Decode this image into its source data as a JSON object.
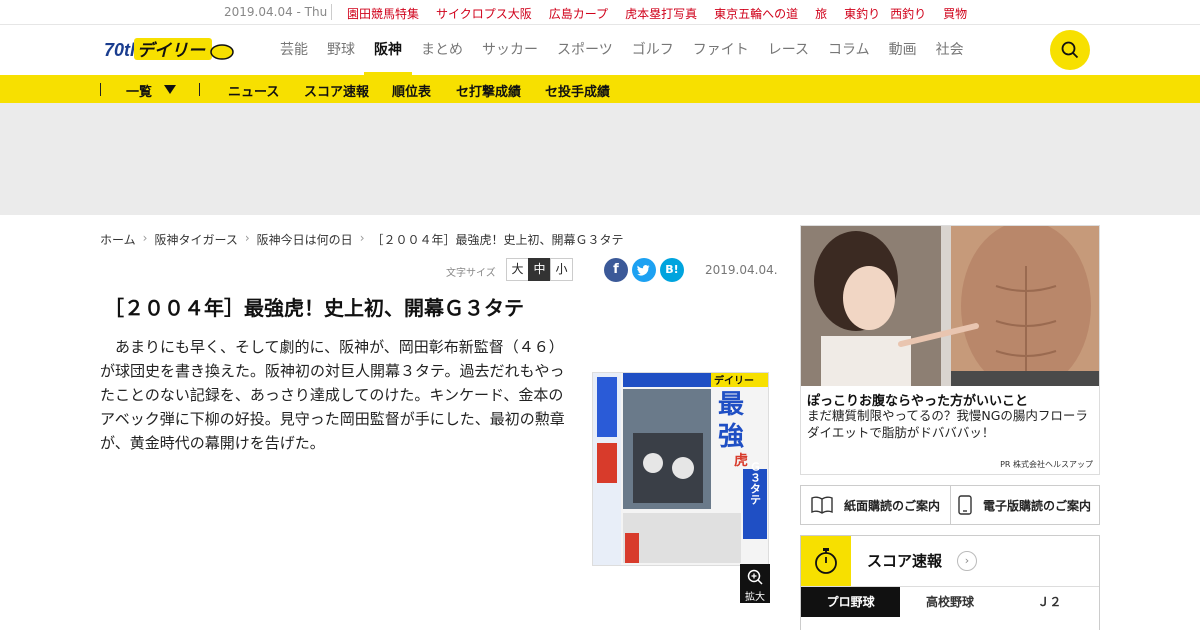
{
  "topbar": {
    "date": "2019.04.04 - Thu",
    "links": [
      "園田競馬特集",
      "サイクロプス大阪",
      "広島カープ",
      "虎本塁打写真",
      "東京五輪への道",
      "旅",
      "東釣り",
      "西釣り",
      "買物"
    ]
  },
  "header": {
    "logo_text": "デイリー",
    "logo_badge": "70th",
    "nav": [
      "芸能",
      "野球",
      "阪神",
      "まとめ",
      "サッカー",
      "スポーツ",
      "ゴルフ",
      "ファイト",
      "レース",
      "コラム",
      "動画",
      "社会"
    ],
    "active_nav": "阪神"
  },
  "subnav": {
    "list": "一覧",
    "items": [
      "ニュース",
      "スコア速報",
      "順位表",
      "セ打撃成績",
      "セ投手成績"
    ]
  },
  "breadcrumb": [
    "ホーム",
    "阪神タイガース",
    "阪神今日は何の日",
    "［２００４年］最強虎！史上初、開幕Ｇ３タテ"
  ],
  "article": {
    "fontsize_label": "文字サイズ",
    "fontsize": [
      "大",
      "中",
      "小"
    ],
    "fontsize_selected": "中",
    "date": "2019.04.04.",
    "title": "［２００４年］最強虎！史上初、開幕Ｇ３タテ",
    "body": "あまりにも早く、そして劇的に、阪神が、岡田彰布新監督（４６）が球団史を書き換えた。阪神初の対巨人開幕３タテ。過去だれもやったことのない記録を、あっさり達成してのけた。キンケード、金本のアベック弾に下柳の好投。見守った岡田監督が手にした、最初の勲章が、黄金時代の幕開けを告げた。",
    "zoom_label": "拡大"
  },
  "share": [
    {
      "name": "facebook",
      "glyph": "f",
      "color": "#3b5998"
    },
    {
      "name": "twitter",
      "glyph": "t",
      "color": "#1da1f2"
    },
    {
      "name": "hatena",
      "glyph": "B!",
      "color": "#00a4de"
    }
  ],
  "paper": {
    "masthead": "デイリー",
    "headline1": "最",
    "headline2": "強",
    "headline3": "虎",
    "side": "Ｇ３タテ"
  },
  "ad": {
    "headline": "ぽっこりお腹ならやった方がいいこと",
    "desc": "まだ糖質制限やってるの？我慢NGの腸内フローラダイエットで脂肪がドバババッ！",
    "pr": "PR 株式会社ヘルスアップ"
  },
  "subscribe": [
    "紙面購読のご案内",
    "電子版購読のご案内"
  ],
  "score": {
    "label": "スコア速報",
    "tabs": [
      "プロ野球",
      "高校野球",
      "Ｊ２"
    ],
    "active_tab": "プロ野球"
  },
  "colors": {
    "brand_yellow": "#f7e000",
    "link_red": "#d0021b"
  }
}
